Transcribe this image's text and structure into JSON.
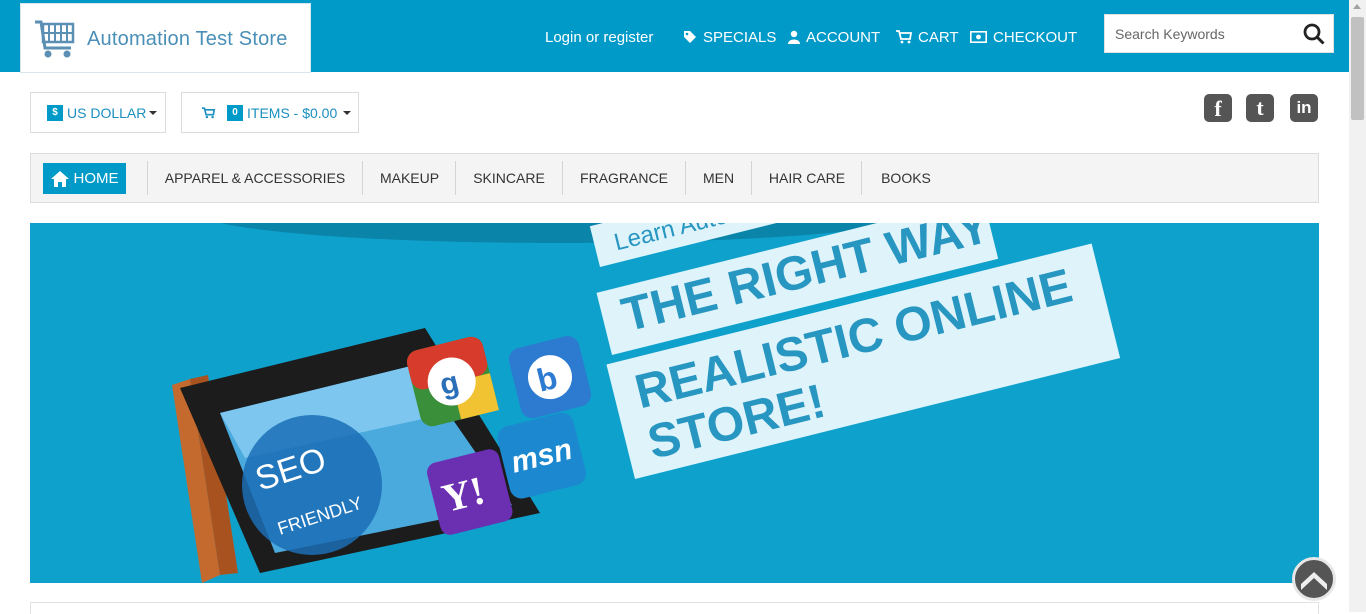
{
  "header": {
    "store_name": "Automation Test Store",
    "login_link": "Login or register",
    "nav": [
      {
        "label": "SPECIALS",
        "icon": "tag-icon"
      },
      {
        "label": "ACCOUNT",
        "icon": "user-icon"
      },
      {
        "label": "CART",
        "icon": "cart-icon"
      },
      {
        "label": "CHECKOUT",
        "icon": "money-icon"
      }
    ],
    "search_placeholder": "Search Keywords"
  },
  "currency": {
    "symbol": "$",
    "label": "US DOLLAR"
  },
  "cart_summary": {
    "count": "0",
    "label": "ITEMS - $0.00"
  },
  "social": [
    {
      "name": "facebook",
      "glyph": "f"
    },
    {
      "name": "twitter",
      "glyph": "t"
    },
    {
      "name": "linkedin",
      "glyph": "in"
    }
  ],
  "categories": [
    "APPAREL & ACCESSORIES",
    "MAKEUP",
    "SKINCARE",
    "FRAGRANCE",
    "MEN",
    "HAIR CARE",
    "BOOKS"
  ],
  "home_label": "HOME",
  "banner": {
    "line1": "Learn Automation",
    "line2": "THE RIGHT WAY",
    "line3a": "REALISTIC ONLINE",
    "line3b": "STORE!",
    "screen_text1": "SEO",
    "screen_text2": "FRIENDLY",
    "app_tiles": [
      "g",
      "b",
      "msn",
      "Y!"
    ]
  },
  "colors": {
    "brand": "#009ac9",
    "link": "#1a8fc0"
  }
}
